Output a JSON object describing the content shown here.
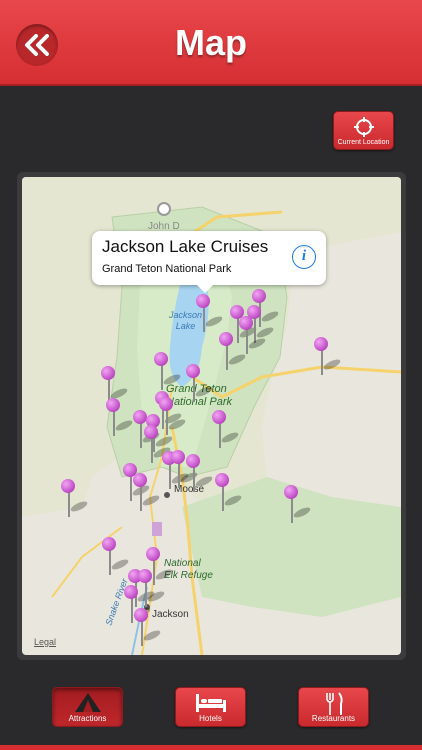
{
  "header": {
    "title": "Map"
  },
  "current_location": {
    "label": "Current Location"
  },
  "callout": {
    "title": "Jackson Lake Cruises",
    "subtitle": "Grand Teton National Park"
  },
  "map_labels": {
    "john_d": "John D",
    "jackson_lake_1": "Jackson",
    "jackson_lake_2": "Lake",
    "grand_teton_1": "Grand Teton",
    "grand_teton_2": "National Park",
    "moose": "Moose",
    "national_elk_1": "National",
    "national_elk_2": "Elk Refuge",
    "snake_river": "Snake River",
    "jackson": "Jackson",
    "legal": "Legal"
  },
  "tabs": [
    {
      "label": "Attractions",
      "icon": "tent-icon",
      "active": true
    },
    {
      "label": "Hotels",
      "icon": "bed-icon",
      "active": false
    },
    {
      "label": "Restaurants",
      "icon": "fork-knife-icon",
      "active": false
    }
  ],
  "colors": {
    "accent": "#d62f33",
    "pin": "#c24fc7",
    "park_green": "#cfe3c0",
    "water": "#a7d4f1",
    "road": "#f5d26b"
  }
}
